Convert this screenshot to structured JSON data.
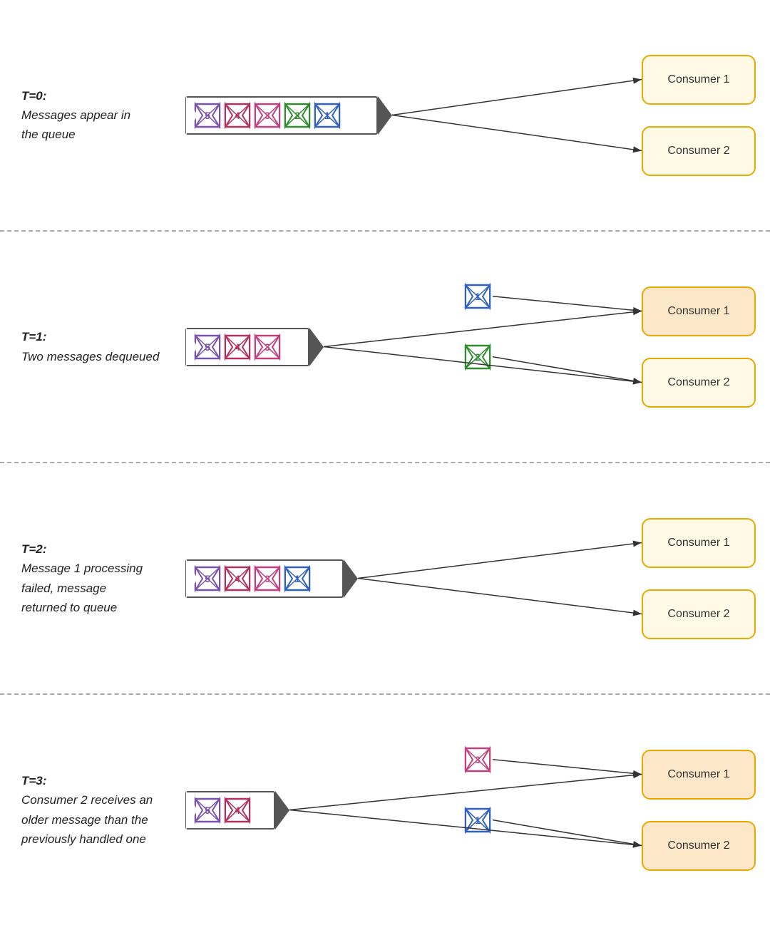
{
  "rows": [
    {
      "id": "t0",
      "time_label": "T=0:",
      "description": "Messages appear in\nthe queue",
      "queue_messages": [
        {
          "num": 5,
          "color": "#7b52ab"
        },
        {
          "num": 4,
          "color": "#b03060"
        },
        {
          "num": 3,
          "color": "#c04080"
        },
        {
          "num": 2,
          "color": "#2e8b2e"
        },
        {
          "num": 1,
          "color": "#3060c0"
        }
      ],
      "floating": [],
      "consumer1_active": false,
      "consumer2_active": false
    },
    {
      "id": "t1",
      "time_label": "T=1:",
      "description": "Two messages dequeued",
      "queue_messages": [
        {
          "num": 5,
          "color": "#7b52ab"
        },
        {
          "num": 4,
          "color": "#b03060"
        },
        {
          "num": 3,
          "color": "#c04080"
        }
      ],
      "floating": [
        {
          "num": 1,
          "color": "#3060c0",
          "target": "consumer1"
        },
        {
          "num": 2,
          "color": "#2e8b2e",
          "target": "consumer2"
        }
      ],
      "consumer1_active": true,
      "consumer2_active": false
    },
    {
      "id": "t2",
      "time_label": "T=2:",
      "description": "Message 1 processing\nfailed, message\nreturned to queue",
      "queue_messages": [
        {
          "num": 5,
          "color": "#7b52ab"
        },
        {
          "num": 4,
          "color": "#b03060"
        },
        {
          "num": 3,
          "color": "#c04080"
        },
        {
          "num": 1,
          "color": "#3060c0"
        }
      ],
      "floating": [],
      "consumer1_active": false,
      "consumer2_active": false
    },
    {
      "id": "t3",
      "time_label": "T=3:",
      "description": "Consumer 2 receives an\nolder message than the\npreviously handled one",
      "queue_messages": [
        {
          "num": 5,
          "color": "#7b52ab"
        },
        {
          "num": 4,
          "color": "#b03060"
        }
      ],
      "floating": [
        {
          "num": 3,
          "color": "#c04080",
          "target": "consumer1"
        },
        {
          "num": 1,
          "color": "#3060c0",
          "target": "consumer2"
        }
      ],
      "consumer1_active": true,
      "consumer2_active": true
    }
  ],
  "consumer_label_1": "Consumer 1",
  "consumer_label_2": "Consumer 2"
}
